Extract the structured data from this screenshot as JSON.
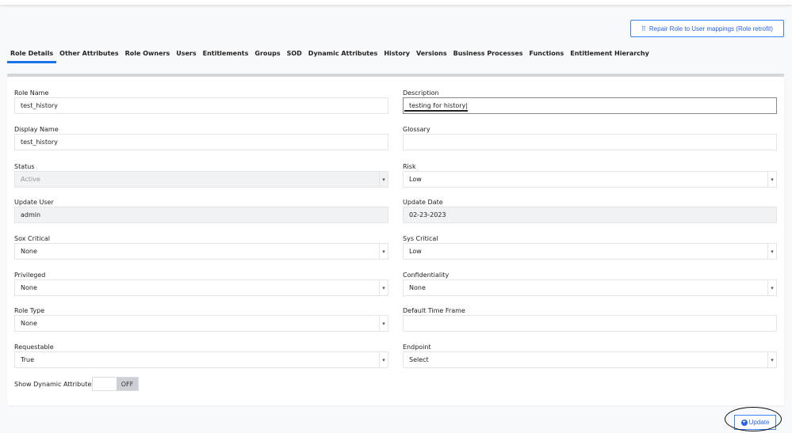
{
  "header": {
    "repair_button": "Repair Role to User mappings (Role retrofit)"
  },
  "tabs": [
    {
      "label": "Role Details",
      "active": true
    },
    {
      "label": "Other Attributes"
    },
    {
      "label": "Role Owners"
    },
    {
      "label": "Users"
    },
    {
      "label": "Entitlements"
    },
    {
      "label": "Groups"
    },
    {
      "label": "SOD"
    },
    {
      "label": "Dynamic Attributes"
    },
    {
      "label": "History"
    },
    {
      "label": "Versions"
    },
    {
      "label": "Business Processes"
    },
    {
      "label": "Functions"
    },
    {
      "label": "Entitlement Hierarchy"
    }
  ],
  "form": {
    "role_name": {
      "label": "Role Name",
      "value": "test_history"
    },
    "description": {
      "label": "Description",
      "value": "testing for history|"
    },
    "display_name": {
      "label": "Display Name",
      "value": "test_history"
    },
    "glossary": {
      "label": "Glossary",
      "value": ""
    },
    "status": {
      "label": "Status",
      "value": "Active"
    },
    "risk": {
      "label": "Risk",
      "value": "Low"
    },
    "update_user": {
      "label": "Update User",
      "value": "admin"
    },
    "update_date": {
      "label": "Update Date",
      "value": "02-23-2023"
    },
    "sox_critical": {
      "label": "Sox Critical",
      "value": "None"
    },
    "sys_critical": {
      "label": "Sys Critical",
      "value": "Low"
    },
    "privileged": {
      "label": "Privileged",
      "value": "None"
    },
    "confidentiality": {
      "label": "Confidentiality",
      "value": "None"
    },
    "role_type": {
      "label": "Role Type",
      "value": "None"
    },
    "default_time_frame": {
      "label": "Default Time Frame",
      "value": ""
    },
    "requestable": {
      "label": "Requestable",
      "value": "True"
    },
    "endpoint": {
      "label": "Endpoint",
      "value": "Select"
    },
    "show_dynamic": {
      "label": "Show Dynamic Attributes",
      "state": "OFF"
    }
  },
  "footer": {
    "update_button": "Update"
  },
  "colors": {
    "accent": "#1a73e8"
  }
}
